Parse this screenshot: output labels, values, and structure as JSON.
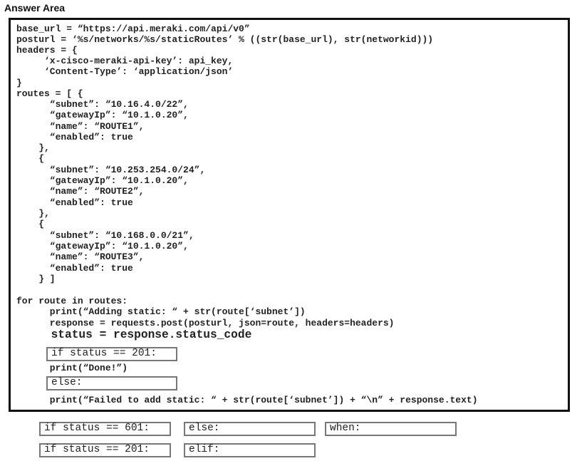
{
  "title": "Answer Area",
  "code": {
    "lines": [
      "base_url = “https://api.meraki.com/api/v0”",
      "posturl = ‘%s/networks/%s/staticRoutes’ % ((str(base_url), str(networkid)))",
      "headers = {",
      "     ‘x-cisco-meraki-api-key’: api_key,",
      "     ‘Content-Type’: ‘application/json’",
      "}",
      "routes = [ {",
      "      “subnet”: “10.16.4.0/22”,",
      "      “gatewayIp”: “10.1.0.20”,",
      "      “name”: “ROUTE1”,",
      "      “enabled”: true",
      "    },",
      "    {",
      "      “subnet”: “10.253.254.0/24”,",
      "      “gatewayIp”: “10.1.0.20”,",
      "      “name”: “ROUTE2”,",
      "      “enabled”: true",
      "    },",
      "    {",
      "      “subnet”: “10.168.0.0/21”,",
      "      “gatewayIp”: “10.1.0.20”,",
      "      “name”: “ROUTE3”,",
      "      “enabled”: true",
      "    } ]",
      "",
      "for route in routes:",
      "      print(“Adding static: “ + str(route[‘subnet’])",
      "      response = requests.post(posturl, json=route, headers=headers)",
      "     status = response.status_code",
      "      print(“Done!”)",
      "      print(“Failed to add static: “ + str(route[‘subnet’]) + “\\n” + response.text)"
    ]
  },
  "slots": [
    {
      "value": "if status == 201:"
    },
    {
      "value": "else:"
    }
  ],
  "options": [
    {
      "label": "if status == 601:"
    },
    {
      "label": "else:"
    },
    {
      "label": "when:"
    },
    {
      "label": "if status == 201:"
    },
    {
      "label": "elif:"
    }
  ]
}
